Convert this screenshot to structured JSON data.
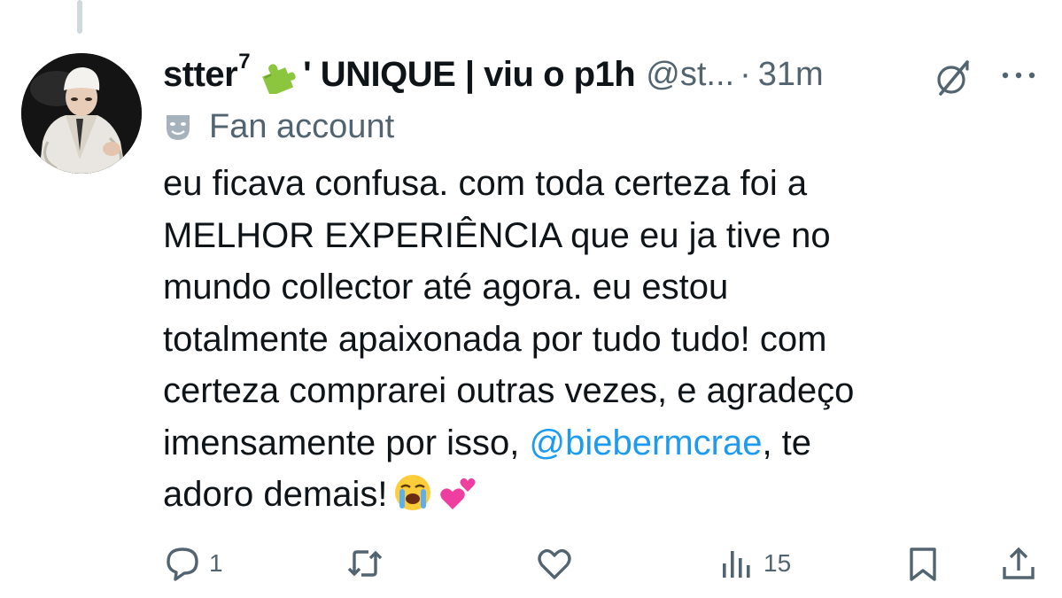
{
  "tweet": {
    "display_name_prefix": "stter",
    "display_name_sup": "7",
    "display_name_suffix": "' UNIQUE | viu o p1h",
    "handle": "@st...",
    "separator": "·",
    "time": "31m",
    "account_label": "Fan account",
    "text_before_mention": "eu ficava confusa. com toda certeza foi a\nMELHOR EXPERIÊNCIA que eu ja tive no\nmundo collector até agora. eu estou\ntotalmente apaixonada por tudo tudo! com\ncerteza comprarei outras vezes, e agradeço\nimensamente por isso, ",
    "mention": "@biebermcrae",
    "text_after_mention": ", te\nadoro demais!",
    "emojis": [
      "loudly-crying-face",
      "two-hearts"
    ]
  },
  "actions": {
    "replies": "1",
    "reposts": "",
    "likes": "",
    "views": "15"
  },
  "icons": {
    "puzzle": "puzzle-piece-icon",
    "grok": "grok-icon",
    "more": "more-icon",
    "mask": "performing-arts-icon",
    "reply": "reply-icon",
    "repost": "repost-icon",
    "like": "heart-icon",
    "views": "views-icon",
    "bookmark": "bookmark-icon",
    "share": "share-icon"
  },
  "colors": {
    "text": "#0f1419",
    "secondary": "#536471",
    "link": "#1d9bf0",
    "thread_line": "#cfd9de"
  }
}
